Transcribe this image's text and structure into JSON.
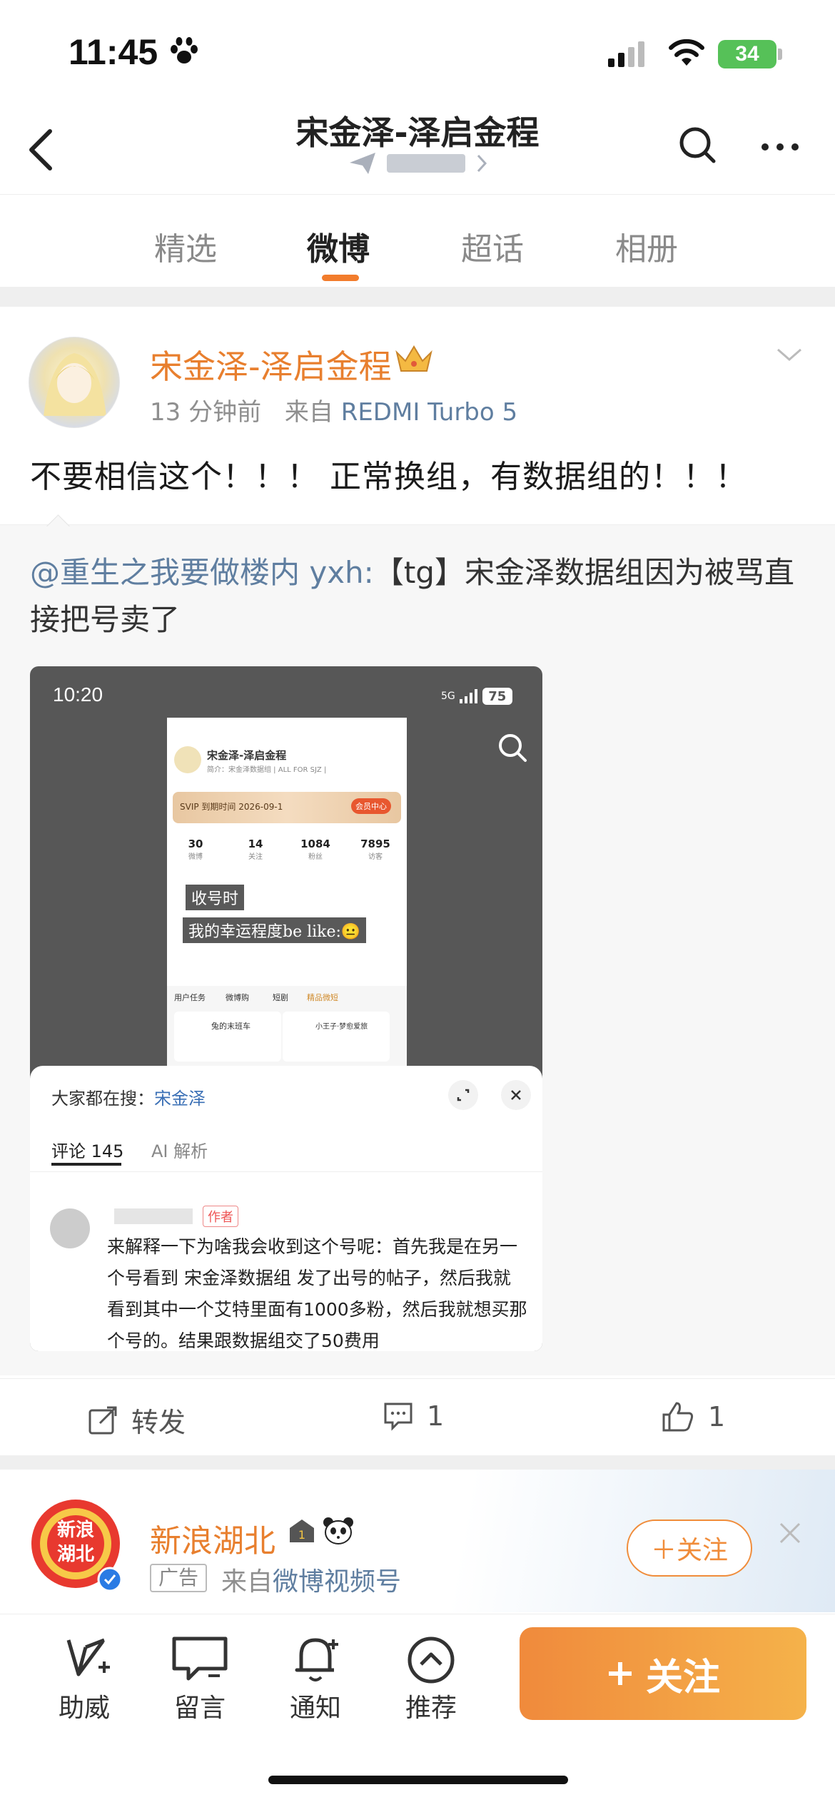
{
  "status_bar": {
    "time": "11:45",
    "battery": "34"
  },
  "nav": {
    "title": "宋金泽-泽启金程"
  },
  "tabs": [
    "精选",
    "微博",
    "超话",
    "相册"
  ],
  "post": {
    "author": "宋金泽-泽启金程",
    "time": "13 分钟前",
    "from_label": "来自",
    "device": "REDMI Turbo 5",
    "text": "不要相信这个！！！ 正常换组，有数据组的！！！",
    "repost_mention": "@重生之我要做楼内 yxh:",
    "repost_text": "【tg】宋金泽数据组因为被骂直接把号卖了"
  },
  "embed": {
    "time": "10:20",
    "battery": "75",
    "signal_label": "5G",
    "profile_name": "宋金泽-泽启金程",
    "profile_bio": "简介：宋金泽数据组 | ALL FOR SJZ |",
    "vip_text": "SVIP 到期时间 2026-09-1",
    "member_center": "会员中心",
    "stats": [
      {
        "value": "30",
        "label": "微博"
      },
      {
        "value": "14",
        "label": "关注"
      },
      {
        "value": "1084",
        "label": "粉丝"
      },
      {
        "value": "7895",
        "label": "访客"
      }
    ],
    "caption_1": "收号时",
    "caption_2": "我的幸运程度be like:😐",
    "task_tabs": [
      "用户任务",
      "微博购",
      "短剧",
      "精品微短"
    ],
    "card_1": "兔的末班车",
    "card_2": "小王子·梦愈爱旅",
    "search_label": "大家都在搜：",
    "search_keyword": "宋金泽",
    "comments_tab": "评论 145",
    "ai_tab": "AI 解析",
    "author_badge": "作者",
    "comment_text": "来解释一下为啥我会收到这个号呢：首先我是在另一个号看到 宋金泽数据组  发了出号的帖子，然后我就看到其中一个艾特里面有1000多粉，然后我就想买那个号的。结果跟数据组交了50费用"
  },
  "actions": {
    "repost": "转发",
    "comments": "1",
    "likes": "1"
  },
  "ad": {
    "name": "新浪湖北",
    "tag": "广告",
    "from_label": "来自",
    "source": "微博视频号",
    "follow": "＋关注",
    "logo_text": "新浪湖北"
  },
  "toolbar": {
    "items": [
      "助威",
      "留言",
      "通知",
      "推荐"
    ],
    "follow": "关注"
  },
  "colors": {
    "accent": "#e87f2e",
    "link": "#5f7ea0",
    "follow_gradient": [
      "#f08a3c",
      "#f5b24a"
    ]
  }
}
